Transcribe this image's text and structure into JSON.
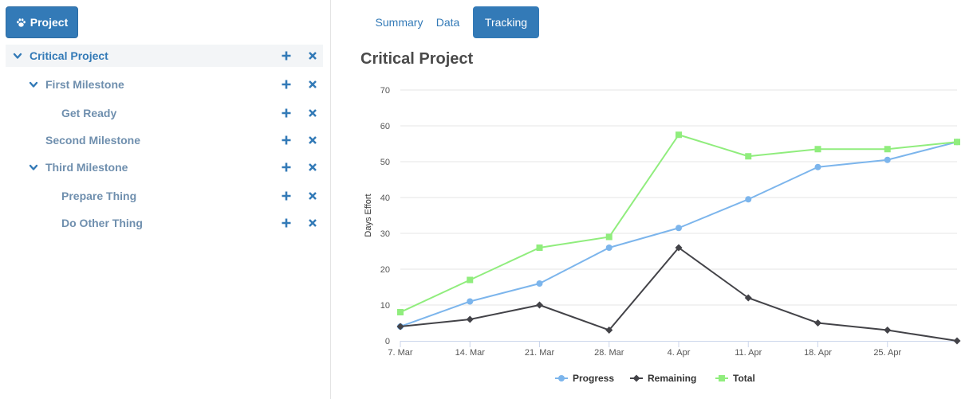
{
  "left_panel": {
    "project_button_label": "Project",
    "tree": [
      {
        "label": "Critical Project",
        "expanded": true,
        "selected": true
      },
      {
        "label": "First Milestone",
        "expanded": true
      },
      {
        "label": "Get Ready"
      },
      {
        "label": "Second Milestone"
      },
      {
        "label": "Third Milestone",
        "expanded": true
      },
      {
        "label": "Prepare Thing"
      },
      {
        "label": "Do Other Thing"
      }
    ]
  },
  "tabs": [
    {
      "label": "Summary",
      "active": false
    },
    {
      "label": "Data",
      "active": false
    },
    {
      "label": "Tracking",
      "active": true
    }
  ],
  "colors": {
    "accent": "#337ab7",
    "progress": "#7cb5ec",
    "remaining": "#434348",
    "total": "#90ed7d"
  },
  "chart_data": {
    "type": "line",
    "title": "Critical Project",
    "ylabel": "Days Effort",
    "xlabel": "",
    "x_ticks": [
      "7. Mar",
      "14. Mar",
      "21. Mar",
      "28. Mar",
      "4. Apr",
      "11. Apr",
      "18. Apr",
      "25. Apr"
    ],
    "x": [
      "2016-03-07",
      "2016-03-14",
      "2016-03-21",
      "2016-03-28",
      "2016-04-04",
      "2016-04-11",
      "2016-04-18",
      "2016-04-25",
      "2016-05-02"
    ],
    "ylim": [
      0,
      70
    ],
    "y_ticks": [
      0,
      10,
      20,
      30,
      40,
      50,
      60,
      70
    ],
    "grid": true,
    "legend_position": "bottom",
    "series": [
      {
        "name": "Progress",
        "marker": "circle",
        "values": [
          4,
          11,
          16,
          26,
          31.5,
          39.5,
          48.5,
          50.5,
          55.5
        ]
      },
      {
        "name": "Remaining",
        "marker": "diamond",
        "values": [
          4,
          6,
          10,
          3,
          26,
          12,
          5,
          3,
          0
        ]
      },
      {
        "name": "Total",
        "marker": "square",
        "values": [
          8,
          17,
          26,
          29,
          57.5,
          51.5,
          53.5,
          53.5,
          55.5
        ]
      }
    ]
  }
}
